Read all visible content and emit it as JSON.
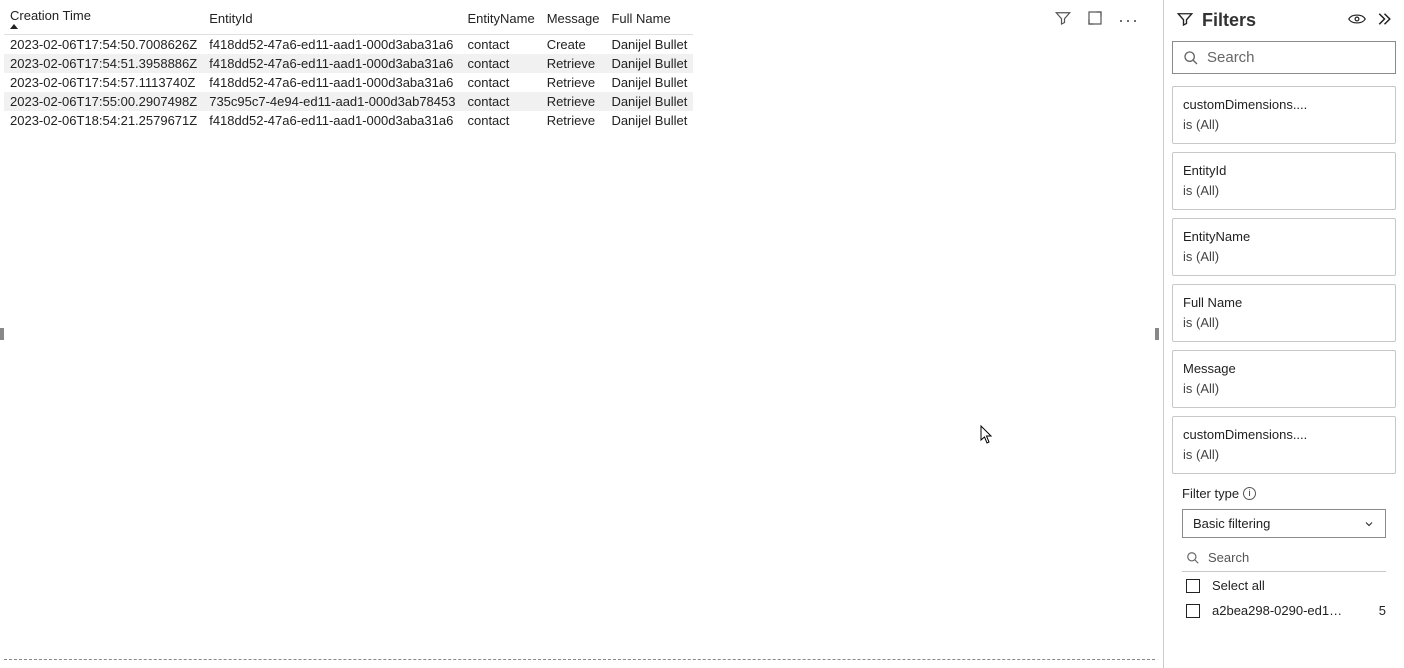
{
  "table": {
    "columns": [
      "Creation Time",
      "EntityId",
      "EntityName",
      "Message",
      "Full Name"
    ],
    "sorted_col_index": 0,
    "rows": [
      {
        "creation": "2023-02-06T17:54:50.7008626Z",
        "eid": "f418dd52-47a6-ed11-aad1-000d3aba31a6",
        "ename": "contact",
        "msg": "Create",
        "full": "Danijel Bullet"
      },
      {
        "creation": "2023-02-06T17:54:51.3958886Z",
        "eid": "f418dd52-47a6-ed11-aad1-000d3aba31a6",
        "ename": "contact",
        "msg": "Retrieve",
        "full": "Danijel Bullet"
      },
      {
        "creation": "2023-02-06T17:54:57.1113740Z",
        "eid": "f418dd52-47a6-ed11-aad1-000d3aba31a6",
        "ename": "contact",
        "msg": "Retrieve",
        "full": "Danijel Bullet"
      },
      {
        "creation": "2023-02-06T17:55:00.2907498Z",
        "eid": "735c95c7-4e94-ed11-aad1-000d3ab78453",
        "ename": "contact",
        "msg": "Retrieve",
        "full": "Danijel Bullet"
      },
      {
        "creation": "2023-02-06T18:54:21.2579671Z",
        "eid": "f418dd52-47a6-ed11-aad1-000d3aba31a6",
        "ename": "contact",
        "msg": "Retrieve",
        "full": "Danijel Bullet"
      }
    ]
  },
  "filters_panel": {
    "title": "Filters",
    "search_placeholder": "Search",
    "cards": [
      {
        "name": "customDimensions....",
        "value": "is (All)"
      },
      {
        "name": "EntityId",
        "value": "is (All)"
      },
      {
        "name": "EntityName",
        "value": "is (All)"
      },
      {
        "name": "Full Name",
        "value": "is (All)"
      },
      {
        "name": "Message",
        "value": "is (All)"
      }
    ],
    "active": {
      "name": "customDimensions....",
      "value": "is (All)",
      "filter_type_label": "Filter type",
      "filter_type_value": "Basic filtering",
      "search_placeholder": "Search",
      "select_all": "Select all",
      "option_label": "a2bea298-0290-ed1…",
      "option_count": "5"
    }
  }
}
